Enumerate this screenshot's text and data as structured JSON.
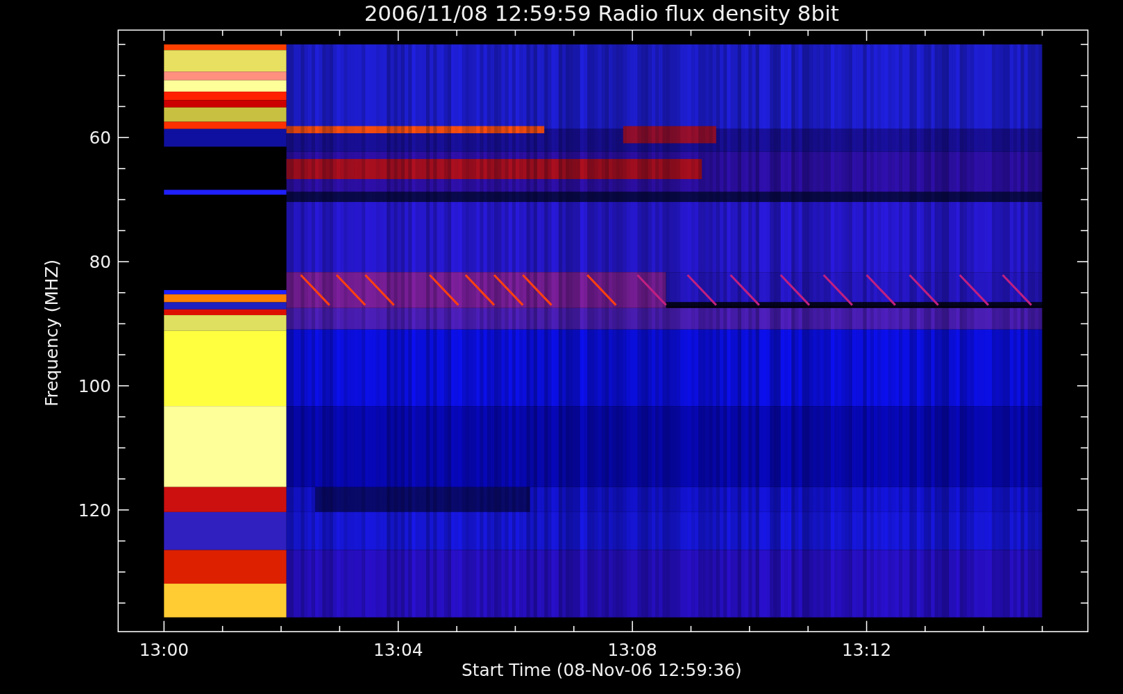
{
  "title": "2006/11/08 12:59:59 Radio flux density 8bit",
  "plot": {
    "xlabel": "Start Time (08-Nov-06 12:59:36)",
    "ylabel": "Frequency (MHZ)",
    "xticks": [
      "13:00",
      "13:04",
      "13:08",
      "13:12"
    ],
    "yticks": [
      "60",
      "80",
      "100",
      "120"
    ]
  }
}
